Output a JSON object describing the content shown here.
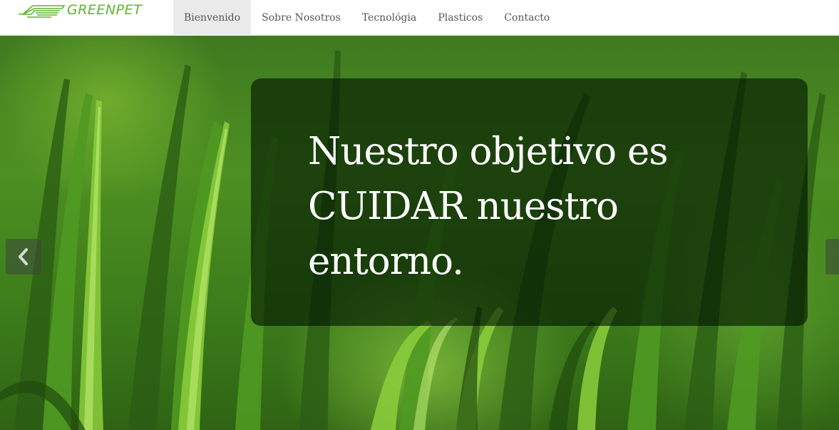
{
  "brand": {
    "name": "GREENPET",
    "color": "#5fb42c"
  },
  "nav": {
    "items": [
      {
        "label": "Bienvenido",
        "active": true
      },
      {
        "label": "Sobre Nosotros",
        "active": false
      },
      {
        "label": "Tecnológia",
        "active": false
      },
      {
        "label": "Plasticos",
        "active": false
      },
      {
        "label": "Contacto",
        "active": false
      }
    ]
  },
  "hero": {
    "caption_line1": "Nuestro objetivo es",
    "caption_line2": "CUIDAR nuestro",
    "caption_line3": "entorno.",
    "prev_icon": "chevron-left-icon",
    "next_icon": "chevron-right-icon"
  }
}
